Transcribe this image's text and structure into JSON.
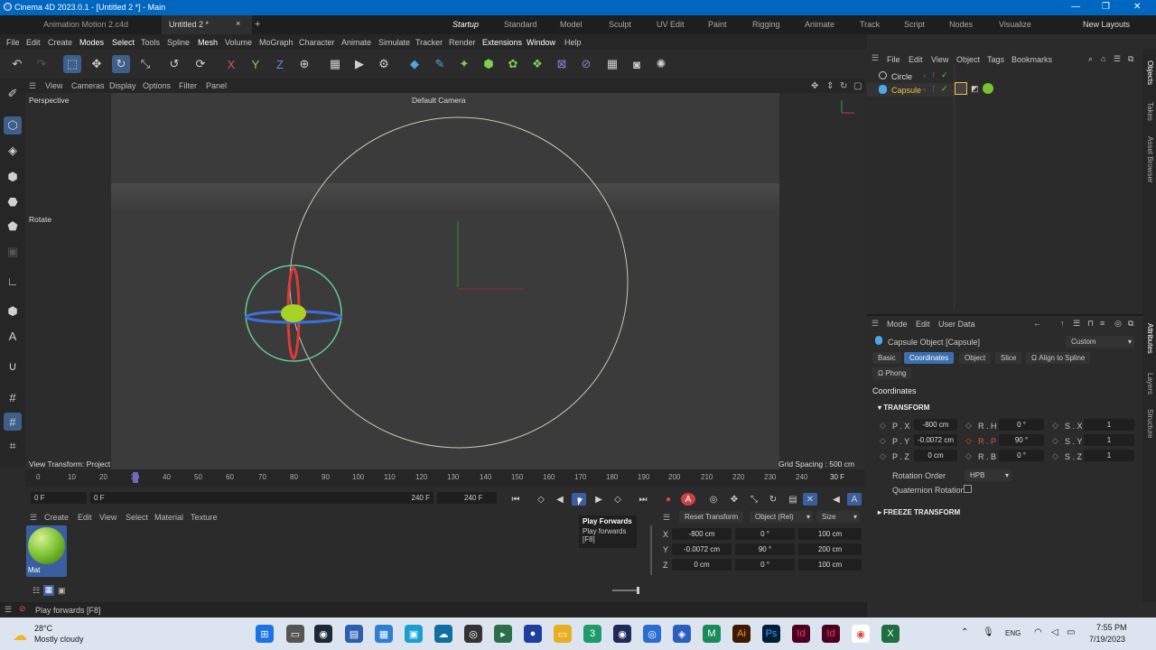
{
  "window": {
    "title": "Cinema 4D 2023.0.1 - [Untitled 2 *] - Main",
    "min": "—",
    "max": "❐",
    "close": "✕"
  },
  "doc_tabs": [
    {
      "label": "Animation Motion 2.c4d"
    },
    {
      "label": "Untitled 2 *"
    }
  ],
  "doc_tab_close": "×",
  "doc_tab_add": "+",
  "layouts": [
    "Startup",
    "Standard",
    "Model",
    "Sculpt",
    "UV Edit",
    "Paint",
    "Rigging",
    "Animate",
    "Track",
    "Script",
    "Nodes",
    "Visualize"
  ],
  "new_layouts": "New Layouts",
  "menu": [
    "File",
    "Edit",
    "Create",
    "Modes",
    "Select",
    "Tools",
    "Spline",
    "Mesh",
    "Volume",
    "MoGraph",
    "Character",
    "Animate",
    "Simulate",
    "Tracker",
    "Render",
    "Extensions",
    "Window",
    "Help"
  ],
  "toolbar": {
    "x": "X",
    "y": "Y",
    "z": "Z"
  },
  "viewport_menu": [
    "View",
    "Cameras",
    "Display",
    "Options",
    "Filter",
    "Panel"
  ],
  "viewport": {
    "name": "Perspective",
    "camera": "Default Camera",
    "tool": "Rotate",
    "transform": "View Transform: Project",
    "grid": "Grid Spacing : 500 cm"
  },
  "timeline": {
    "ticks": [
      "0",
      "10",
      "20",
      "30",
      "40",
      "50",
      "60",
      "70",
      "80",
      "90",
      "100",
      "110",
      "120",
      "130",
      "140",
      "150",
      "160",
      "170",
      "180",
      "190",
      "200",
      "210",
      "220",
      "230",
      "240"
    ],
    "current_frame": "30 F",
    "start": "0 F",
    "start2": "0 F",
    "end": "240 F",
    "end2": "240 F"
  },
  "tooltip": {
    "title": "Play Forwards",
    "desc": "Play forwards",
    "key": "[F8]"
  },
  "material_menu": [
    "Create",
    "Edit",
    "View",
    "Select",
    "Material",
    "Texture"
  ],
  "material": {
    "name": "Mat",
    "color": "#7bc132"
  },
  "coord": {
    "reset": "Reset Transform",
    "mode": "Object (Rel)",
    "size": "Size",
    "rows": [
      {
        "axis": "X",
        "pos": "-800 cm",
        "rot": "0 °",
        "size": "100 cm"
      },
      {
        "axis": "Y",
        "pos": "-0.0072 cm",
        "rot": "90 °",
        "size": "200 cm"
      },
      {
        "axis": "Z",
        "pos": "0 cm",
        "rot": "0 °",
        "size": "100 cm"
      }
    ]
  },
  "objects_menu": [
    "File",
    "Edit",
    "View",
    "Object",
    "Tags",
    "Bookmarks"
  ],
  "objects": [
    {
      "name": "Circle"
    },
    {
      "name": "Capsule"
    }
  ],
  "attr_menu": [
    "Mode",
    "Edit",
    "User Data"
  ],
  "attr": {
    "object": "Capsule Object [Capsule]",
    "preset": "Custom",
    "tabs": [
      "Basic",
      "Coordinates",
      "Object",
      "Slice",
      "Ω Align to Spline",
      "Ω Phong"
    ],
    "section": "Coordinates",
    "transform": "TRANSFORM",
    "fields": [
      {
        "l1": "P . X",
        "v1": "-800 cm",
        "l2": "R . H",
        "v2": "0 °",
        "l3": "S . X",
        "v3": "1"
      },
      {
        "l1": "P . Y",
        "v1": "-0.0072 cm",
        "l2": "R . P",
        "v2": "90 °",
        "l3": "S . Y",
        "v3": "1"
      },
      {
        "l1": "P . Z",
        "v1": "0 cm",
        "l2": "R . B",
        "v2": "0 °",
        "l3": "S . Z",
        "v3": "1"
      }
    ],
    "rotation_order_label": "Rotation Order",
    "rotation_order": "HPB",
    "quat_label": "Quaternion Rotation",
    "freeze": "FREEZE TRANSFORM"
  },
  "side_tabs": [
    "Objects",
    "Takes",
    "Asset Browser",
    "Attributes",
    "Layers",
    "Structure"
  ],
  "status": "Play forwards [F8]",
  "taskbar": {
    "temp": "28°C",
    "weather": "Mostly cloudy",
    "lang": "ENG",
    "time": "7:55 PM",
    "date": "7/19/2023"
  }
}
